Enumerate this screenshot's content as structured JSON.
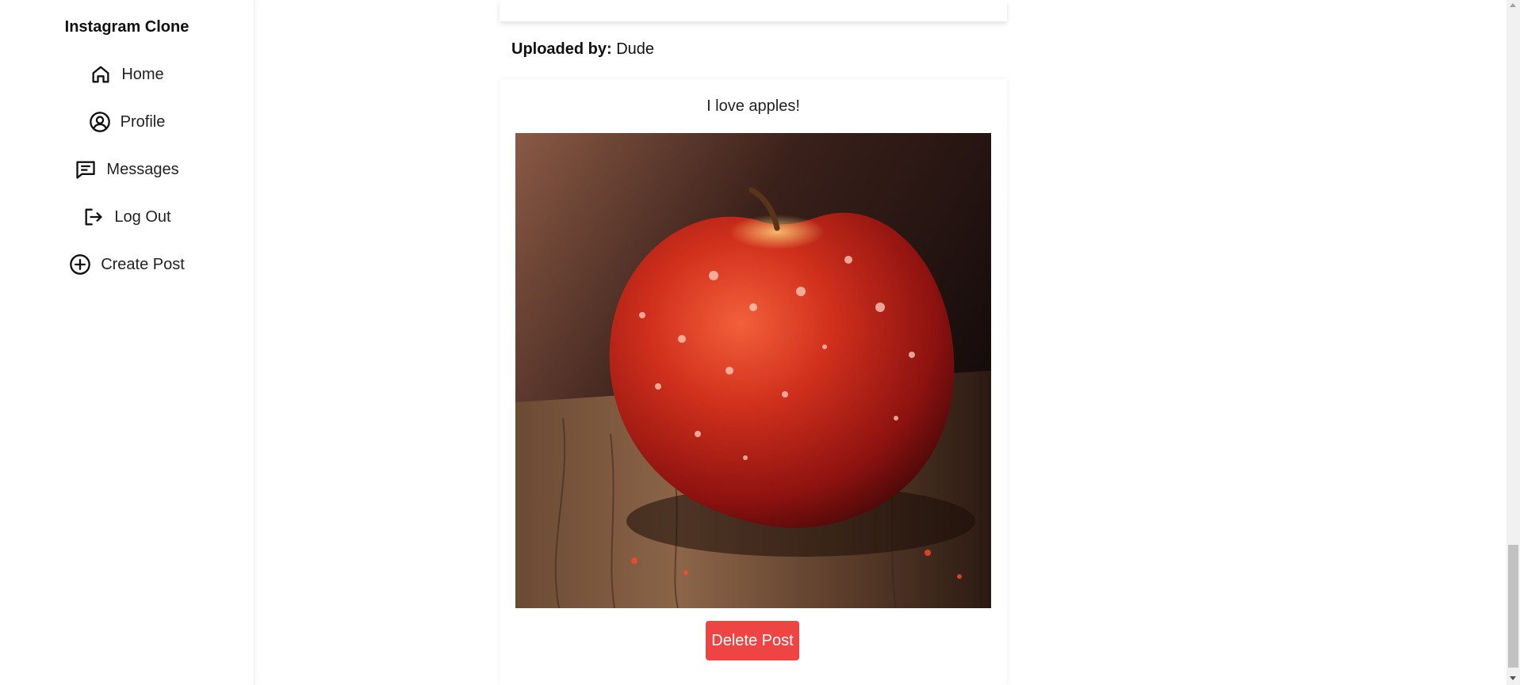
{
  "app": {
    "title": "Instagram Clone"
  },
  "sidebar": {
    "items": [
      {
        "label": "Home",
        "icon": "home-icon"
      },
      {
        "label": "Profile",
        "icon": "user-circle-icon"
      },
      {
        "label": "Messages",
        "icon": "message-icon"
      },
      {
        "label": "Log Out",
        "icon": "logout-icon"
      },
      {
        "label": "Create Post",
        "icon": "plus-circle-icon"
      }
    ]
  },
  "post": {
    "uploaded_label": "Uploaded by:",
    "uploader": "Dude",
    "caption": "I love apples!",
    "image_subject": "apple-photo",
    "delete_label": "Delete Post"
  },
  "colors": {
    "delete_button": "#ef4444",
    "text": "#111111"
  }
}
